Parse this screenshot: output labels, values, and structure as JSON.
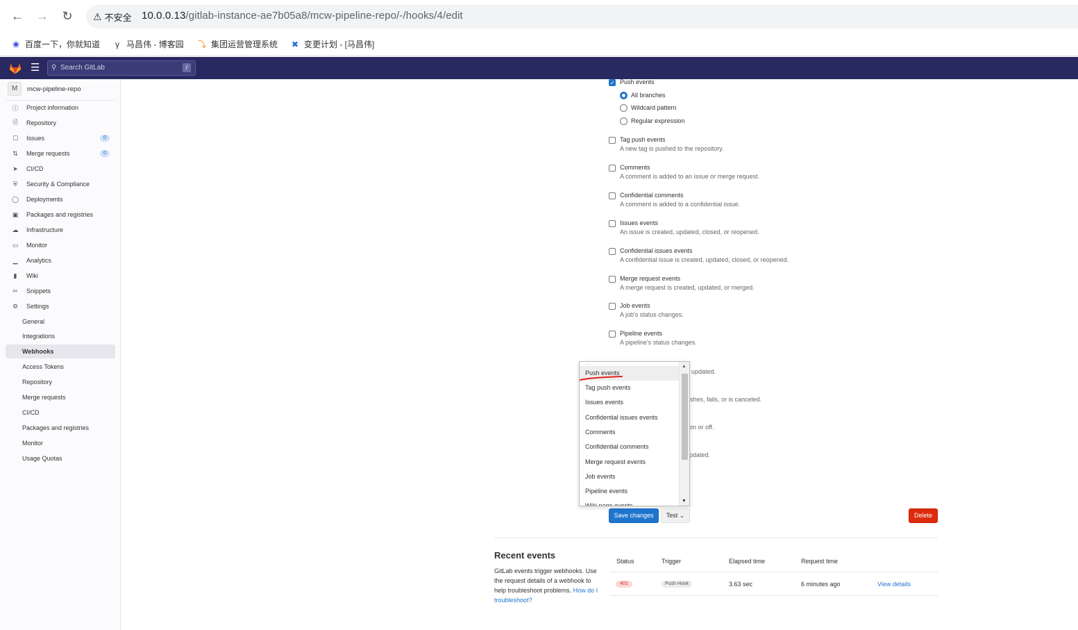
{
  "browser": {
    "security_label": "不安全",
    "url_host": "10.0.0.13",
    "url_path": "/gitlab-instance-ae7b05a8/mcw-pipeline-repo/-/hooks/4/edit",
    "bookmarks": [
      "百度一下，你就知道",
      "马昌伟 - 博客园",
      "集团运营管理系统",
      "变更计划 - [马昌伟]"
    ]
  },
  "topbar": {
    "search_placeholder": "Search GitLab",
    "search_shortcut": "/"
  },
  "sidebar": {
    "project_initial": "M",
    "project_name": "mcw-pipeline-repo",
    "items": [
      {
        "label": "Project information",
        "icon": "info-icon"
      },
      {
        "label": "Repository",
        "icon": "document-icon"
      },
      {
        "label": "Issues",
        "icon": "issues-icon",
        "badge": "0"
      },
      {
        "label": "Merge requests",
        "icon": "merge-request-icon",
        "badge": "0"
      },
      {
        "label": "CI/CD",
        "icon": "rocket-icon"
      },
      {
        "label": "Security & Compliance",
        "icon": "shield-icon"
      },
      {
        "label": "Deployments",
        "icon": "deployments-icon"
      },
      {
        "label": "Packages and registries",
        "icon": "package-icon"
      },
      {
        "label": "Infrastructure",
        "icon": "cloud-icon"
      },
      {
        "label": "Monitor",
        "icon": "monitor-icon"
      },
      {
        "label": "Analytics",
        "icon": "chart-icon"
      },
      {
        "label": "Wiki",
        "icon": "book-icon"
      },
      {
        "label": "Snippets",
        "icon": "scissors-icon"
      },
      {
        "label": "Settings",
        "icon": "gear-icon"
      }
    ],
    "settings_sub": [
      "General",
      "Integrations",
      "Webhooks",
      "Access Tokens",
      "Repository",
      "Merge requests",
      "CI/CD",
      "Packages and registries",
      "Monitor",
      "Usage Quotas"
    ],
    "active_sub": "Webhooks"
  },
  "triggers": {
    "push": {
      "label": "Push events",
      "checked": true
    },
    "branch_options": [
      {
        "label": "All branches",
        "selected": true
      },
      {
        "label": "Wildcard pattern",
        "selected": false
      },
      {
        "label": "Regular expression",
        "selected": false
      }
    ],
    "events": [
      {
        "label": "Tag push events",
        "desc": "A new tag is pushed to the repository."
      },
      {
        "label": "Comments",
        "desc": "A comment is added to an issue or merge request."
      },
      {
        "label": "Confidential comments",
        "desc": "A comment is added to a confidential issue."
      },
      {
        "label": "Issues events",
        "desc": "An issue is created, updated, closed, or reopened."
      },
      {
        "label": "Confidential issues events",
        "desc": "A confidential issue is created, updated, closed, or reopened."
      },
      {
        "label": "Merge request events",
        "desc": "A merge request is created, updated, or merged."
      },
      {
        "label": "Job events",
        "desc": "A job's status changes."
      },
      {
        "label": "Pipeline events",
        "desc": "A pipeline's status changes."
      }
    ],
    "partial_fragments": [
      "updated.",
      "shes, fails, or is canceled.",
      "on or off.",
      "pdated."
    ]
  },
  "test_dropdown": {
    "items": [
      "Push events",
      "Tag push events",
      "Issues events",
      "Confidential issues events",
      "Comments",
      "Confidential comments",
      "Merge request events",
      "Job events",
      "Pipeline events",
      "Wiki page events"
    ],
    "highlighted": "Push events",
    "annotation_color": "#e0201b"
  },
  "actions": {
    "save_label": "Save changes",
    "test_label": "Test",
    "delete_label": "Delete"
  },
  "recent_events": {
    "title": "Recent events",
    "desc_text": "GitLab events trigger webhooks. Use the request details of a webhook to help troubleshoot problems.",
    "desc_link": "How do I troubleshoot?",
    "columns": [
      "Status",
      "Trigger",
      "Elapsed time",
      "Request time"
    ],
    "rows": [
      {
        "status": "401",
        "trigger": "Push Hook",
        "elapsed": "3.63 sec",
        "request_time": "6 minutes ago",
        "link": "View details"
      }
    ]
  },
  "colors": {
    "topbar": "#292961",
    "primary": "#1f75cb",
    "danger": "#dd2b0e"
  }
}
